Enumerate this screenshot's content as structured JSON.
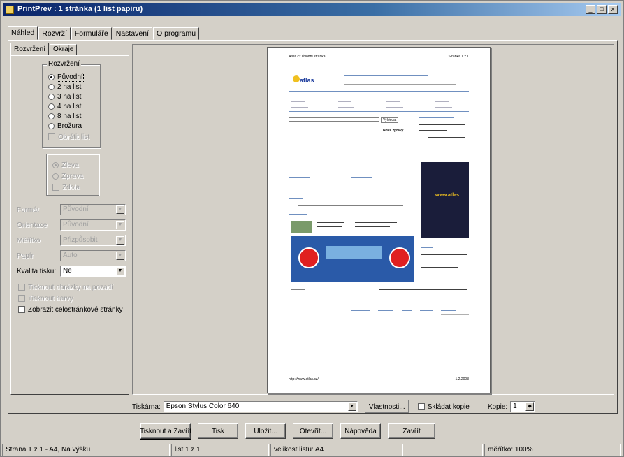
{
  "window": {
    "title": "PrintPrev : 1 stránka (1 list papíru)",
    "buttons": [
      "_",
      "□",
      "x"
    ]
  },
  "main_tabs": [
    {
      "label": "Náhled",
      "active": true
    },
    {
      "label": "Rozvrží",
      "active": false
    },
    {
      "label": "Formuláře",
      "active": false
    },
    {
      "label": "Nastavení",
      "active": false
    },
    {
      "label": "O programu",
      "active": false
    }
  ],
  "sub_tabs": [
    {
      "label": "Rozvržení",
      "active": true
    },
    {
      "label": "Okraje",
      "active": false
    }
  ],
  "layout_group": {
    "label": "Rozvržení",
    "options": [
      {
        "label": "Původní",
        "checked": true,
        "focused": true
      },
      {
        "label": "2 na list",
        "checked": false
      },
      {
        "label": "3 na list",
        "checked": false
      },
      {
        "label": "4 na list",
        "checked": false
      },
      {
        "label": "8 na list",
        "checked": false
      },
      {
        "label": "Brožura",
        "checked": false
      }
    ],
    "disabled_check": "Obrátit list"
  },
  "order_group": {
    "options": [
      "Zleva",
      "Zprava",
      "Zdola"
    ]
  },
  "fields": [
    {
      "label": "Formát",
      "value": "Původní"
    },
    {
      "label": "Orientace",
      "value": "Původní"
    },
    {
      "label": "Měřítko",
      "value": "Přizpůsobit"
    },
    {
      "label": "Papír",
      "value": "Auto"
    }
  ],
  "quality": {
    "label": "Kvalita tisku:",
    "value": "Ne"
  },
  "checkboxes": [
    {
      "label": "Tisknout obrázky na pozadí",
      "disabled": true
    },
    {
      "label": "Tisknout barvy",
      "disabled": true
    },
    {
      "label": "Zobrazit celostránkové stránky",
      "disabled": false
    }
  ],
  "preview": {
    "header_left": "Atlas.cz Úvodní stránka",
    "header_right": "Stránka 1 z 1",
    "brand": "atlas",
    "search_button": "Vyhledat",
    "column_title": "Nová zprávy",
    "banner_text": "www.atlas",
    "footer_left": "http://www.atlas.cz/",
    "footer_right": "1.2.2003"
  },
  "printer": {
    "label": "Tiskárna:",
    "value": "Epson Stylus Color 640",
    "properties_button": "Vlastnosti...",
    "copies_label": "Kopie:",
    "copies_value": "1",
    "collate_label": "Skládat kopie"
  },
  "buttons": [
    "Tisknout a Zavřít",
    "Tisk",
    "Uložit...",
    "Otevřít...",
    "Nápověda",
    "Zavřít"
  ],
  "status": [
    "Strana 1 z 1 - A4, Na výšku",
    "list 1 z 1",
    "velikost listu: A4",
    "",
    "měřítko: 100%"
  ]
}
